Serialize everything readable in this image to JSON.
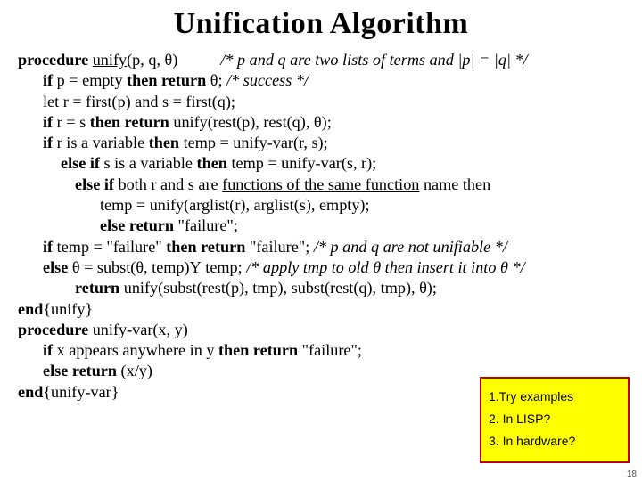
{
  "title": "Unification Algorithm",
  "lines": {
    "l0a": "procedure",
    "l0b": "unify",
    "l0c": "(p, q, θ)",
    "l0d": "/* p and q are two lists of terms and |p| = |q| */",
    "l1a": "if",
    "l1b": " p = empty ",
    "l1c": "then return",
    "l1d": " θ; ",
    "l1e": "/* success */",
    "l2": "let r = first(p) and s = first(q);",
    "l3a": "if",
    "l3b": " r = s ",
    "l3c": "then return",
    "l3d": " unify(rest(p), rest(q), θ);",
    "l4a": "if",
    "l4b": " r is a variable ",
    "l4c": "then",
    "l4d": " temp = unify-var(r, s);",
    "l5a": "else if",
    "l5b": " s is a variable ",
    "l5c": "then",
    "l5d": " temp = unify-var(s, r);",
    "l6a": "else if",
    "l6b": " both r and s are ",
    "l6c": "functions of the same function",
    "l6d": " name then",
    "l7": "temp = unify(arglist(r), arglist(s), empty);",
    "l8a": "else return",
    "l8b": " \"failure\";",
    "l9a": "if",
    "l9b": " temp = \"failure\" ",
    "l9c": "then return",
    "l9d": " \"failure\";  ",
    "l9e": "/* p and q are not unifiable */",
    "l10a": "else",
    "l10b": " θ = subst(θ, temp)",
    "l10c": "Y",
    "l10d": " temp;  ",
    "l10e": "/* apply tmp to old θ then insert it into θ */",
    "l11a": "return",
    "l11b": " unify(subst(rest(p), tmp), subst(rest(q), tmp), θ);",
    "l12a": "end",
    "l12b": "{unify}",
    "l13a": "procedure",
    "l13b": " unify-var(x, y)",
    "l14a": "if",
    "l14b": " x appears anywhere in y ",
    "l14c": "then return",
    "l14d": " \"failure\";",
    "l15a": "else return",
    "l15b": " (x/y)",
    "l16a": "end",
    "l16b": "{unify-var}"
  },
  "notes": {
    "n1": "1.Try examples",
    "n2": "2. In LISP?",
    "n3": "3. In hardware?"
  },
  "pagenum": "18"
}
